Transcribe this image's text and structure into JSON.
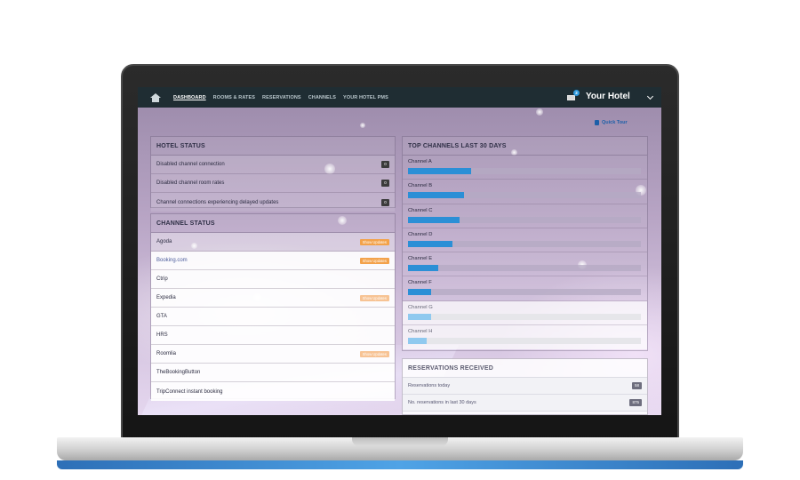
{
  "nav": {
    "items": [
      {
        "label": "DASHBOARD",
        "active": true
      },
      {
        "label": "ROOMS & RATES",
        "active": false
      },
      {
        "label": "RESERVATIONS",
        "active": false
      },
      {
        "label": "CHANNELS",
        "active": false
      },
      {
        "label": "YOUR HOTEL PMS",
        "active": false
      }
    ],
    "notification_count": "2",
    "hotel_name": "Your Hotel"
  },
  "quick_tour": "Quick Tour",
  "hotel_status": {
    "title": "HOTEL STATUS",
    "rows": [
      {
        "label": "Disabled channel connection",
        "count": "0"
      },
      {
        "label": "Disabled channel room rates",
        "count": "0"
      },
      {
        "label": "Channel connections experiencing delayed updates",
        "count": "0"
      }
    ]
  },
  "channel_status": {
    "title": "CHANNEL STATUS",
    "button_label": "Show Updates",
    "rows": [
      {
        "label": "Agoda",
        "has_updates": true
      },
      {
        "label": "Booking.com",
        "has_updates": true
      },
      {
        "label": "Ctrip",
        "has_updates": false
      },
      {
        "label": "Expedia",
        "has_updates": true
      },
      {
        "label": "GTA",
        "has_updates": false
      },
      {
        "label": "HRS",
        "has_updates": false
      },
      {
        "label": "Roomlia",
        "has_updates": true
      },
      {
        "label": "TheBookingButton",
        "has_updates": false
      },
      {
        "label": "TripConnect instant booking",
        "has_updates": false
      }
    ]
  },
  "top_channels": {
    "title": "TOP CHANNELS LAST 30 DAYS",
    "colors": {
      "strong": "#2b8fd6",
      "light": "#8fc9ef"
    },
    "channels": [
      {
        "label": "Channel A",
        "share": 0.27
      },
      {
        "label": "Channel B",
        "share": 0.24
      },
      {
        "label": "Channel C",
        "share": 0.22
      },
      {
        "label": "Channel D",
        "share": 0.19
      },
      {
        "label": "Channel E",
        "share": 0.13
      },
      {
        "label": "Channel F",
        "share": 0.1
      },
      {
        "label": "Channel G",
        "share": 0.1
      },
      {
        "label": "Channel H",
        "share": 0.08
      }
    ]
  },
  "reservations": {
    "title": "RESERVATIONS RECEIVED",
    "rows": [
      {
        "label": "Reservations today",
        "value": "58"
      },
      {
        "label": "No. reservations in last 30 days",
        "value": "875"
      }
    ]
  }
}
